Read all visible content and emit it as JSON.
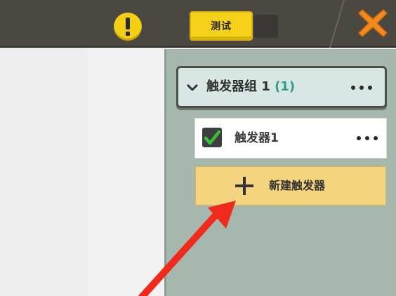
{
  "topbar": {
    "test_label": "测试",
    "warning_icon": "exclamation-icon",
    "close_icon": "close-icon"
  },
  "trigger_panel": {
    "group": {
      "name": "触发器组 1",
      "count": "(1)",
      "chevron_icon": "chevron-down-icon",
      "menu_icon": "more-options-icon"
    },
    "triggers": [
      {
        "name": "触发器1",
        "checked": true,
        "menu_icon": "more-options-icon"
      }
    ],
    "new_trigger_label": "新建触发器"
  },
  "annotation": {
    "arrow_color": "#f02a1c"
  },
  "colors": {
    "topbar_bg": "#4b4741",
    "accent_yellow": "#f6d11a",
    "panel_bg": "#a6b8ad",
    "close_orange": "#f28a1e",
    "check_green": "#3bbf3b"
  }
}
